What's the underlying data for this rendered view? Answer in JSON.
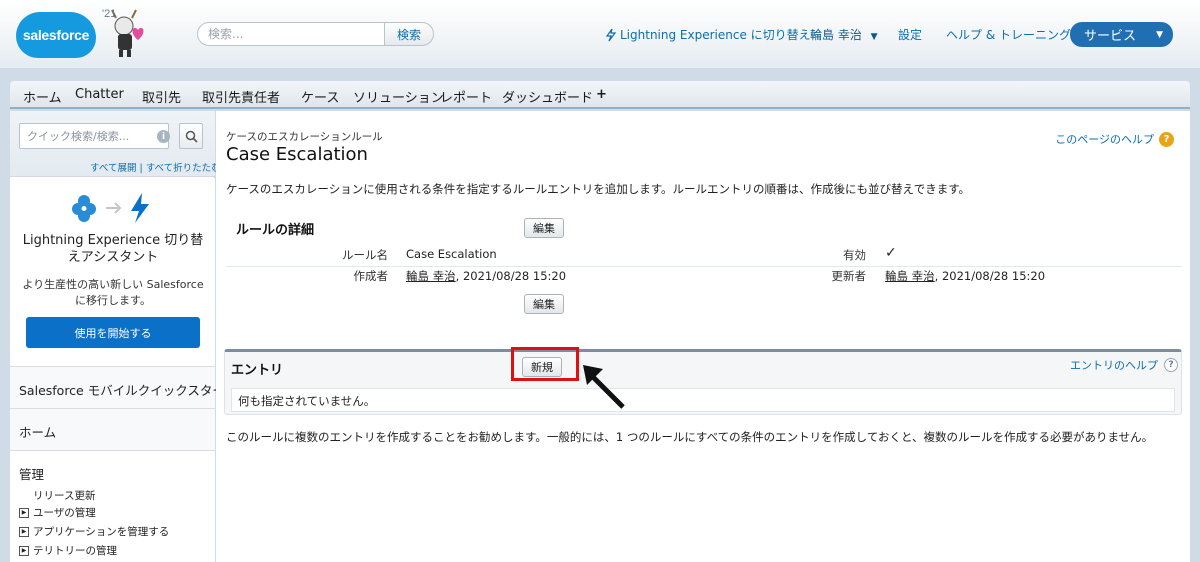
{
  "header": {
    "logo_text": "salesforce",
    "release_badge": "'21",
    "search_placeholder": "検索...",
    "search_button": "検索",
    "lightning_switch": "Lightning Experience に切り替え",
    "user_name": "輪島 幸治",
    "settings": "設定",
    "help_training": "ヘルプ & トレーニング",
    "app_menu": "サービス"
  },
  "nav": {
    "tabs": [
      "ホーム",
      "Chatter",
      "取引先",
      "取引先責任者",
      "ケース",
      "ソリューション",
      "レポート",
      "ダッシュボード"
    ],
    "add_tab": "+"
  },
  "sidebar": {
    "search_placeholder": "クイック検索/検索...",
    "expand_collapse": "すべて展開 | すべて折りたたむ",
    "lightning_assistant_title": "Lightning Experience 切り替えアシスタント",
    "lightning_assistant_desc": "より生産性の高い新しい Salesforce に移行します。",
    "start_button": "使用を開始する",
    "mobile_quickstart": "Salesforce モバイルクイックスタート",
    "home": "ホーム",
    "admin": "管理",
    "release_updates": "リリース更新",
    "tree": [
      "ユーザの管理",
      "アプリケーションを管理する",
      "テリトリーの管理"
    ]
  },
  "main": {
    "breadcrumb": "ケースのエスカレーションルール",
    "title": "Case Escalation",
    "page_help": "このページのヘルプ",
    "description": "ケースのエスカレーションに使用される条件を指定するルールエントリを追加します。ルールエントリの順番は、作成後にも並び替えできます。",
    "detail_section_title": "ルールの詳細",
    "edit_button": "編集",
    "rule_name_label": "ルール名",
    "rule_name_value": "Case Escalation",
    "active_label": "有効",
    "active_value": "✓",
    "created_by_label": "作成者",
    "created_by_user": "輪島 幸治",
    "created_by_date": ", 2021/08/28 15:20",
    "modified_by_label": "更新者",
    "modified_by_user": "輪島 幸治",
    "modified_by_date": ", 2021/08/28 15:20",
    "entries_title": "エントリ",
    "new_button": "新規",
    "entries_help": "エントリのヘルプ",
    "entries_empty": "何も指定されていません。",
    "note": "このルールに複数のエントリを作成することをお勧めします。一般的には、1 つのルールにすべての条件のエントリを作成しておくと、複数のルールを作成する必要がありません。"
  },
  "colors": {
    "brand_blue": "#159ae0",
    "app_button": "#1f6fb2",
    "start_button": "#0a70c8",
    "link": "#0d6ea8",
    "highlight_red": "#e01010"
  }
}
